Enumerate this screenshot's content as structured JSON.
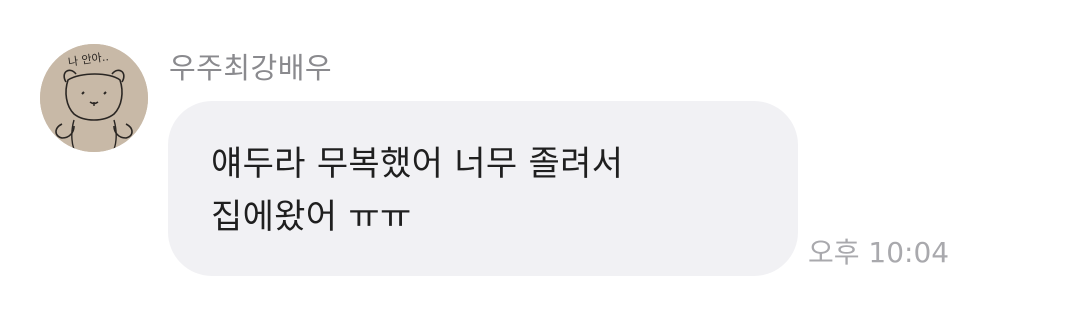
{
  "message": {
    "sender_name": "우주최강배우",
    "avatar_icon": "drawn-bear-avatar",
    "avatar_text": "나 안아..",
    "lines": [
      "얘두라 무복했어 너무 졸려서",
      "집에왔어 ㅠㅠ"
    ],
    "timestamp": "오후 10:04"
  },
  "colors": {
    "bubble": "#f1f1f4",
    "name": "#8a8a8e",
    "text": "#1f1f1f",
    "time": "#a9a9ad"
  }
}
